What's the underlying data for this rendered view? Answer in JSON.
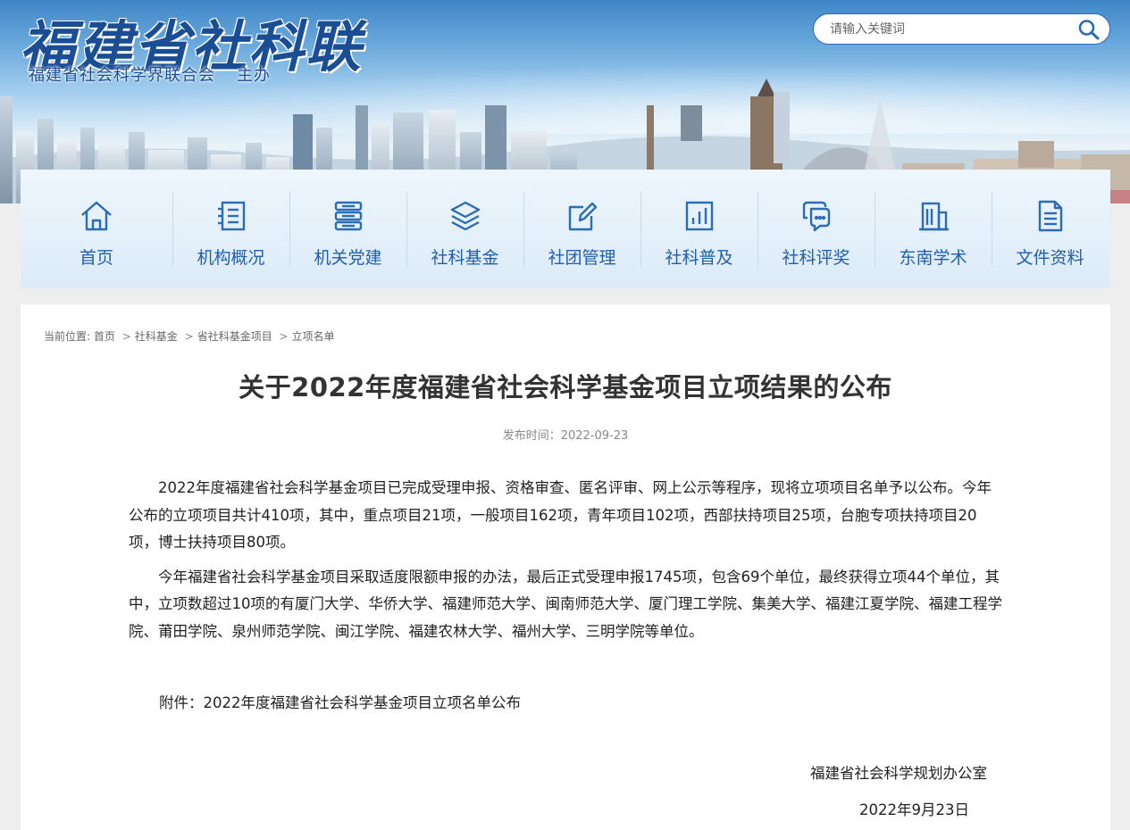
{
  "header": {
    "logo_title": "福建省社科联",
    "logo_subtitle": "福建省社会科学界联合会",
    "logo_host": "主办",
    "search_placeholder": "请输入关键词"
  },
  "nav": {
    "items": [
      {
        "label": "首页",
        "icon": "home-icon"
      },
      {
        "label": "机构概况",
        "icon": "document-list-icon"
      },
      {
        "label": "机关党建",
        "icon": "server-stack-icon"
      },
      {
        "label": "社科基金",
        "icon": "layers-icon"
      },
      {
        "label": "社团管理",
        "icon": "edit-icon"
      },
      {
        "label": "社科普及",
        "icon": "bar-chart-icon"
      },
      {
        "label": "社科评奖",
        "icon": "chat-bubbles-icon"
      },
      {
        "label": "东南学术",
        "icon": "building-icon"
      },
      {
        "label": "文件资料",
        "icon": "file-text-icon"
      }
    ],
    "icon_color": "#2a6cb8",
    "label_color": "#1e5fae"
  },
  "breadcrumb": {
    "prefix": "当前位置:",
    "items": [
      "首页",
      "社科基金",
      "省社科基金项目",
      "立项名单"
    ],
    "separator": ">"
  },
  "article": {
    "title": "关于2022年度福建省社会科学基金项目立项结果的公布",
    "publish_time": "发布时间：2022-09-23",
    "paragraphs": [
      "2022年度福建省社会科学基金项目已完成受理申报、资格审查、匿名评审、网上公示等程序，现将立项项目名单予以公布。今年公布的立项项目共计410项，其中，重点项目21项，一般项目162项，青年项目102项，西部扶持项目25项，台胞专项扶持项目20项，博士扶持项目80项。",
      "今年福建省社会科学基金项目采取适度限额申报的办法，最后正式受理申报1745项，包含69个单位，最终获得立项44个单位，其中，立项数超过10项的有厦门大学、华侨大学、福建师范大学、闽南师范大学、厦门理工学院、集美大学、福建江夏学院、福建工程学院、莆田学院、泉州师范学院、闽江学院、福建农林大学、福州大学、三明学院等单位。"
    ],
    "attachment_label": "附件：",
    "attachment_text": "2022年度福建省社会科学基金项目立项名单公布",
    "signature_org": "福建省社会科学规划办公室",
    "signature_date": "2022年9月23日"
  }
}
